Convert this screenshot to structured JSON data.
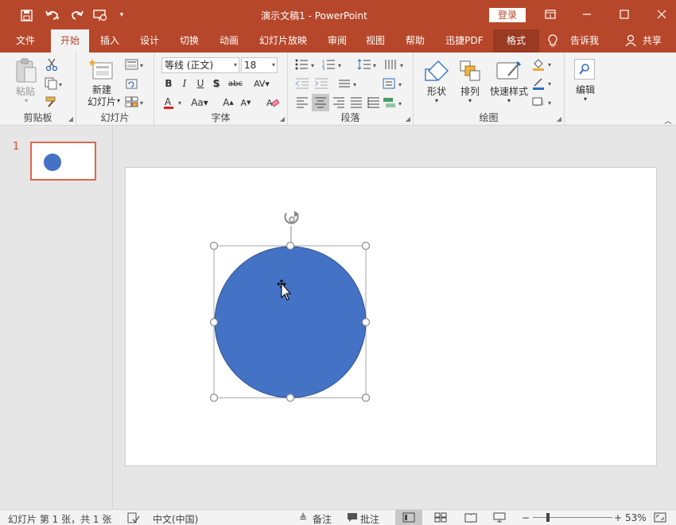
{
  "window": {
    "title": "演示文稿1 - PowerPoint",
    "login_label": "登录"
  },
  "tabs": [
    {
      "label": "文件"
    },
    {
      "label": "开始"
    },
    {
      "label": "插入"
    },
    {
      "label": "设计"
    },
    {
      "label": "切换"
    },
    {
      "label": "动画"
    },
    {
      "label": "幻灯片放映"
    },
    {
      "label": "审阅"
    },
    {
      "label": "视图"
    },
    {
      "label": "帮助"
    },
    {
      "label": "迅捷PDF"
    },
    {
      "label": "格式"
    }
  ],
  "tell_me": "告诉我",
  "share": "共享",
  "ribbon": {
    "clipboard": {
      "label": "剪贴板",
      "paste": "粘贴"
    },
    "slides": {
      "label": "幻灯片",
      "new_slide_1": "新建",
      "new_slide_2": "幻灯片"
    },
    "font": {
      "label": "字体",
      "font_name": "等线 (正文)",
      "font_size": "18"
    },
    "paragraph": {
      "label": "段落"
    },
    "drawing": {
      "label": "绘图",
      "shapes": "形状",
      "arrange": "排列",
      "quick_styles": "快速样式"
    },
    "editing": {
      "label": "编辑"
    }
  },
  "thumbnail": {
    "number": "1"
  },
  "shape": {
    "fill_color": "#4472c4",
    "kind": "circle"
  },
  "status": {
    "slide_info": "幻灯片 第 1 张，共 1 张",
    "language": "中文(中国)",
    "notes": "备注",
    "comments": "批注",
    "zoom": "53%"
  }
}
